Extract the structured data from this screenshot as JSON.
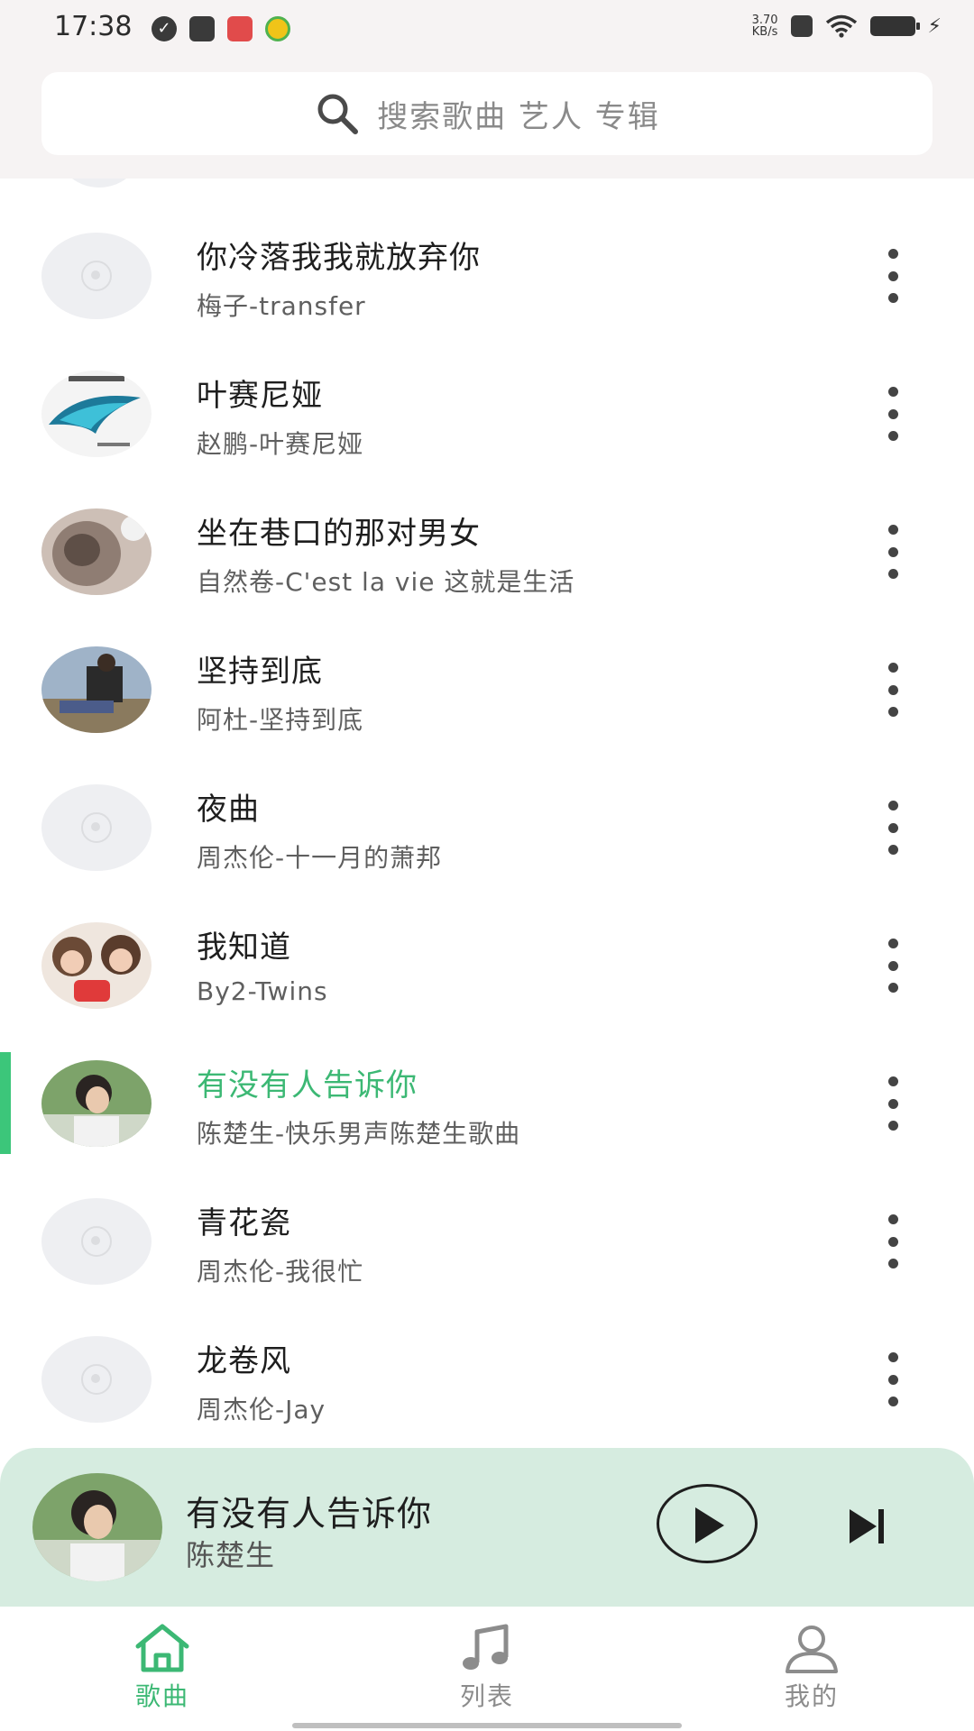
{
  "status_bar": {
    "time": "17:38",
    "net_speed_value": "3.70",
    "net_speed_unit": "KB/s",
    "icons": [
      "check-circle-icon",
      "mail-icon",
      "app-notification-icon",
      "app-notification-icon",
      "close-box-icon",
      "wifi-icon",
      "battery-icon",
      "charging-bolt-icon"
    ]
  },
  "search": {
    "placeholder": "搜索歌曲 艺人 专辑",
    "icon": "search-icon"
  },
  "songs": [
    {
      "title": "你冷落我我就放弃你",
      "subtitle": "梅子-transfer",
      "cover": "placeholder",
      "active": false
    },
    {
      "title": "叶赛尼娅",
      "subtitle": "赵鹏-叶赛尼娅",
      "cover": "album-art",
      "active": false
    },
    {
      "title": "坐在巷口的那对男女",
      "subtitle": "自然卷-C'est la vie 这就是生活",
      "cover": "album-art",
      "active": false
    },
    {
      "title": "坚持到底",
      "subtitle": "阿杜-坚持到底",
      "cover": "album-art",
      "active": false
    },
    {
      "title": "夜曲",
      "subtitle": "周杰伦-十一月的萧邦",
      "cover": "placeholder",
      "active": false
    },
    {
      "title": "我知道",
      "subtitle": "By2-Twins",
      "cover": "album-art",
      "active": false
    },
    {
      "title": "有没有人告诉你",
      "subtitle": "陈楚生-快乐男声陈楚生歌曲",
      "cover": "album-art",
      "active": true
    },
    {
      "title": "青花瓷",
      "subtitle": "周杰伦-我很忙",
      "cover": "placeholder",
      "active": false
    },
    {
      "title": "龙卷风",
      "subtitle": "周杰伦-Jay",
      "cover": "placeholder",
      "active": false
    }
  ],
  "player": {
    "title": "有没有人告诉你",
    "artist": "陈楚生"
  },
  "tabs": [
    {
      "label": "歌曲",
      "icon": "home-icon",
      "active": true
    },
    {
      "label": "列表",
      "icon": "music-note-icon",
      "active": false
    },
    {
      "label": "我的",
      "icon": "person-icon",
      "active": false
    }
  ],
  "colors": {
    "accent": "#3cb874",
    "player_bg": "#d6ece0",
    "header_bg": "#f6f3f3"
  }
}
